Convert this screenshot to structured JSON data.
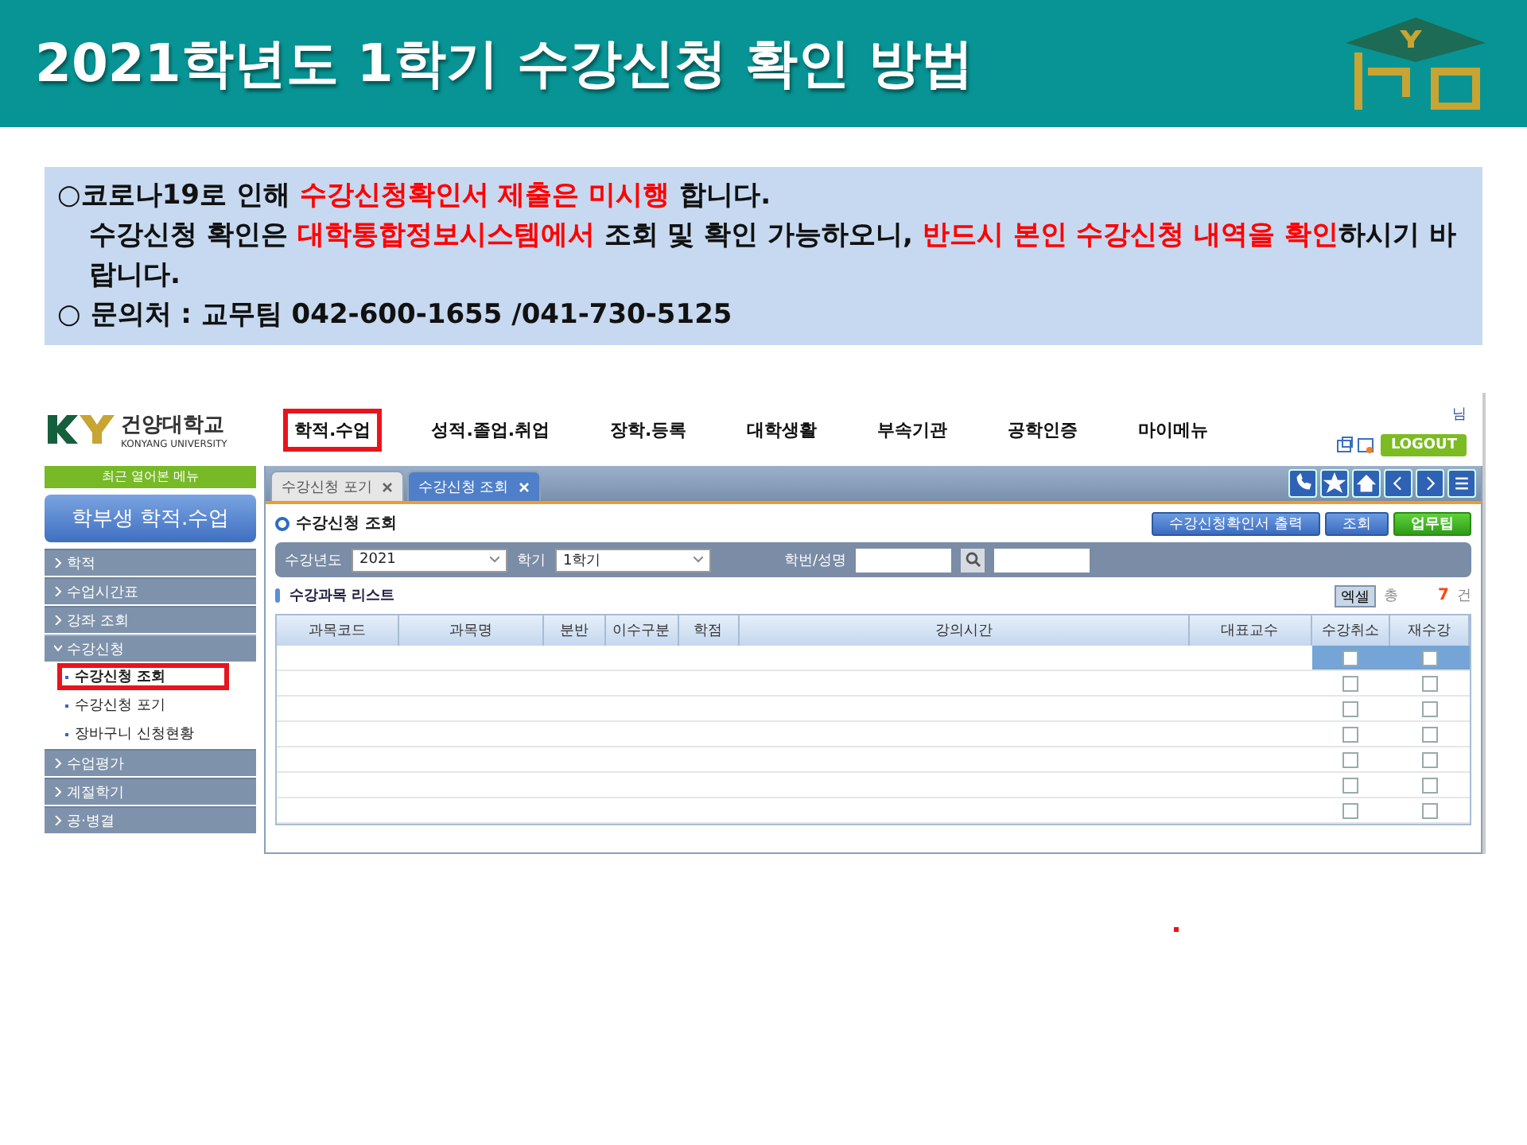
{
  "slide": {
    "title": "2021학년도 1학기 수강신청 확인 방법"
  },
  "notice": {
    "paragraphs": [
      [
        {
          "text": "○코로나19로 인해 ",
          "emphasis": false
        },
        {
          "text": "수강신청확인서 제출은 미시행",
          "emphasis": true
        },
        {
          "text": " 합니다.",
          "emphasis": false
        }
      ],
      [
        {
          "text": "수강신청 확인은 ",
          "emphasis": false
        },
        {
          "text": "대학통합정보시스템에서",
          "emphasis": true
        },
        {
          "text": " 조회 및 확인 가능하오니, ",
          "emphasis": false
        },
        {
          "text": "반드시 본인 수강신청 내역을 확인",
          "emphasis": true
        },
        {
          "text": "하시기 바랍니다.",
          "emphasis": false
        }
      ],
      [
        {
          "text": "○ 문의처 : 교무팀 042-600-1655 /041-730-5125",
          "emphasis": false
        }
      ]
    ]
  },
  "portal": {
    "logo": {
      "name": "건양대학교",
      "subtitle": "KONYANG UNIVERSITY"
    },
    "nav": [
      {
        "label": "학적.수업",
        "highlighted": true
      },
      {
        "label": "성적.졸업.취업",
        "highlighted": false
      },
      {
        "label": "장학.등록",
        "highlighted": false
      },
      {
        "label": "대학생활",
        "highlighted": false
      },
      {
        "label": "부속기관",
        "highlighted": false
      },
      {
        "label": "공학인증",
        "highlighted": false
      },
      {
        "label": "마이메뉴",
        "highlighted": false
      }
    ],
    "user_suffix": "님",
    "logout": "LOGOUT",
    "sidebar": {
      "recent": "최근 열어본 메뉴",
      "heading": "학부생 학적.수업",
      "items": [
        {
          "label": "학적",
          "expanded": false
        },
        {
          "label": "수업시간표",
          "expanded": false
        },
        {
          "label": "강좌 조회",
          "expanded": false
        },
        {
          "label": "수강신청",
          "expanded": true,
          "children": [
            {
              "label": "수강신청 조회",
              "selected": true,
              "highlighted": true
            },
            {
              "label": "수강신청 포기",
              "selected": false,
              "highlighted": false
            },
            {
              "label": "장바구니 신청현황",
              "selected": false,
              "highlighted": false
            }
          ]
        },
        {
          "label": "수업평가",
          "expanded": false
        },
        {
          "label": "계절학기",
          "expanded": false
        },
        {
          "label": "공·병결",
          "expanded": false
        }
      ]
    },
    "tabs": [
      {
        "label": "수강신청 포기",
        "selected": false
      },
      {
        "label": "수강신청 조회",
        "selected": true
      }
    ],
    "page_title": "수강신청 조회",
    "buttons": [
      {
        "label": "수강신청확인서 출력",
        "kind": "primary"
      },
      {
        "label": "조회",
        "kind": "primary"
      },
      {
        "label": "업무팁",
        "kind": "tip"
      }
    ],
    "filters": [
      {
        "label": "수강년도",
        "value": "2021",
        "kind": "select"
      },
      {
        "label": "학기",
        "value": "1학기",
        "kind": "select"
      },
      {
        "label": "학번/성명",
        "kind": "search"
      }
    ],
    "list": {
      "title": "수강과목 리스트",
      "excel": "엑셀",
      "total_label": "총",
      "count": "7",
      "count_unit": "건",
      "columns": [
        "과목코드",
        "과목명",
        "분반",
        "이수구분",
        "학점",
        "강의시간",
        "대표교수",
        "수강취소",
        "재수강"
      ],
      "rows": [
        {
          "selected": true,
          "cancel": false,
          "retake": false
        },
        {
          "selected": false,
          "cancel": false,
          "retake": false
        },
        {
          "selected": false,
          "cancel": false,
          "retake": false
        },
        {
          "selected": false,
          "cancel": false,
          "retake": false
        },
        {
          "selected": false,
          "cancel": false,
          "retake": false
        },
        {
          "selected": false,
          "cancel": false,
          "retake": false
        },
        {
          "selected": false,
          "cancel": false,
          "retake": false
        }
      ]
    }
  }
}
